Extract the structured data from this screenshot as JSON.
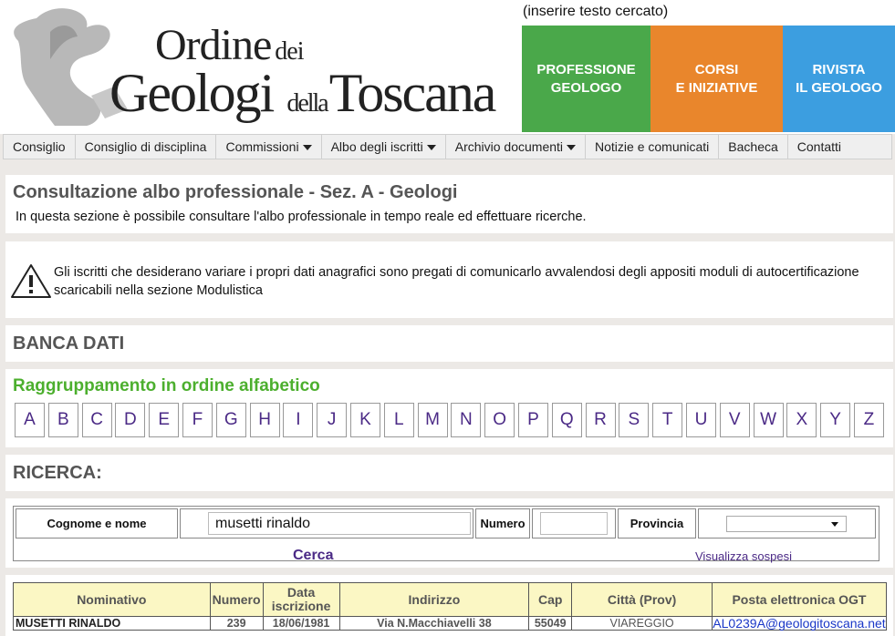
{
  "header": {
    "logo": {
      "line1_big": "Ordine",
      "line1_small": "dei",
      "line2_big1": "Geologi",
      "line2_small": "della",
      "line2_big2": "Toscana"
    },
    "search_hint": "(inserire testo cercato)",
    "tiles": [
      {
        "line1": "PROFESSIONE",
        "line2": "GEOLOGO",
        "color": "#4aa84a"
      },
      {
        "line1": "CORSI",
        "line2": "E INIZIATIVE",
        "color": "#e9862c"
      },
      {
        "line1": "RIVISTA",
        "line2": "IL GEOLOGO",
        "color": "#3c9ee0"
      }
    ]
  },
  "nav": {
    "items": [
      {
        "label": "Consiglio",
        "dropdown": false
      },
      {
        "label": "Consiglio di disciplina",
        "dropdown": false
      },
      {
        "label": "Commissioni",
        "dropdown": true
      },
      {
        "label": "Albo degli iscritti",
        "dropdown": true
      },
      {
        "label": "Archivio documenti",
        "dropdown": true
      },
      {
        "label": "Notizie e comunicati",
        "dropdown": false
      },
      {
        "label": "Bacheca",
        "dropdown": false
      },
      {
        "label": "Contatti",
        "dropdown": false
      }
    ]
  },
  "intro": {
    "title": "Consultazione albo professionale - Sez. A - Geologi",
    "description": "In questa sezione è possibile consultare l'albo professionale in tempo reale ed effettuare ricerche."
  },
  "notice": {
    "icon": "warning-icon",
    "text": "Gli iscritti che desiderano variare i propri dati anagrafici sono pregati di comunicarlo avvalendosi degli appositi moduli di autocertificazione scaricabili nella sezione Modulistica"
  },
  "banca_dati": {
    "heading": "BANCA DATI"
  },
  "alphabet": {
    "heading": "Raggruppamento in ordine alfabetico",
    "letters": [
      "A",
      "B",
      "C",
      "D",
      "E",
      "F",
      "G",
      "H",
      "I",
      "J",
      "K",
      "L",
      "M",
      "N",
      "O",
      "P",
      "Q",
      "R",
      "S",
      "T",
      "U",
      "V",
      "W",
      "X",
      "Y",
      "Z"
    ]
  },
  "ricerca": {
    "heading": "RICERCA:"
  },
  "search_form": {
    "name_label": "Cognome e nome",
    "name_value": "musetti rinaldo",
    "number_label": "Numero",
    "number_value": "",
    "province_label": "Provincia",
    "province_value": "",
    "submit_label": "Cerca",
    "suspended_link": "Visualizza sospesi"
  },
  "results": {
    "headers": {
      "nominativo": "Nominativo",
      "numero": "Numero",
      "data1": "Data",
      "data2": "iscrizione",
      "indirizzo": "Indirizzo",
      "cap": "Cap",
      "citta": "Città (Prov)",
      "email": "Posta elettronica OGT"
    },
    "rows": [
      {
        "nominativo": "MUSETTI RINALDO",
        "numero": "239",
        "data": "18/06/1981",
        "indirizzo": "Via N.Macchiavelli 38",
        "cap": "55049",
        "citta": "VIAREGGIO",
        "email": "AL0239A@geologitoscana.net"
      }
    ]
  }
}
